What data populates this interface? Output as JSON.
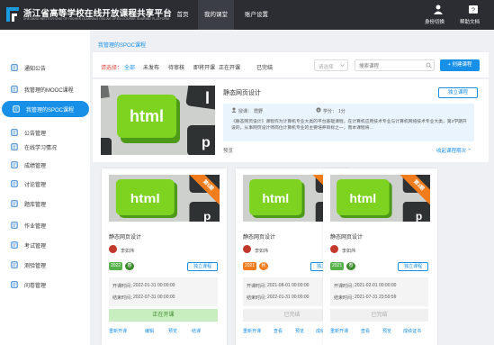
{
  "header": {
    "title": "浙江省高等学校在线开放课程共享平台",
    "subtitle": "ZHEJIANG INSTITUTIONS OF HIGHER LEARNING ONLINE OPEN COURSE SHARING PLATFORM",
    "nav": [
      "首页",
      "我的课堂",
      "账户设置"
    ],
    "actions": [
      {
        "label": "身份切换",
        "icon": "user-switch-icon"
      },
      {
        "label": "帮助文档",
        "icon": "help-icon"
      }
    ]
  },
  "sidebar": {
    "items": [
      {
        "label": "通知公告",
        "icon": "notice-icon"
      },
      {
        "label": "我管理的MOOC课程",
        "icon": "book-icon"
      },
      {
        "label": "我管理的SPOC课程",
        "icon": "book-icon"
      },
      {
        "label": "公告管理",
        "icon": "announce-icon"
      },
      {
        "label": "在线学习情况",
        "icon": "study-icon"
      },
      {
        "label": "成绩管理",
        "icon": "grade-icon"
      },
      {
        "label": "讨论管理",
        "icon": "discuss-icon"
      },
      {
        "label": "题库管理",
        "icon": "question-bank-icon"
      },
      {
        "label": "作业管理",
        "icon": "homework-icon"
      },
      {
        "label": "考试管理",
        "icon": "exam-icon"
      },
      {
        "label": "测验管理",
        "icon": "quiz-icon"
      },
      {
        "label": "问卷管理",
        "icon": "survey-icon"
      }
    ],
    "active_index": 2
  },
  "breadcrumb": "我管理的SPOC课程",
  "filter": {
    "label": "请选择：",
    "options": [
      "全部",
      "未发布",
      "待审核",
      "即将开课",
      "正在开课",
      "已完结"
    ],
    "selected": "全部",
    "select_placeholder": "请选择",
    "search_placeholder": "搜索课程",
    "create_button": "+ 创建课程"
  },
  "featured": {
    "title": "静态网页设计",
    "button": "独立课程",
    "teacher_label": "授课：",
    "teacher": "霓野",
    "credit_label": "学分：",
    "credit": "1分",
    "description": "《静态网页设计》课程作为计算机专业大类的平台基础课程，在计算机应用技术专业与计算机网络技术专业大类，第2学期开设的，从事网页设计师岗位计算机专业的主要培养目标之一，而本课程将…",
    "preview_label": "预览",
    "collapse_label": "收起课程期次 ⌃"
  },
  "cards": [
    {
      "title": "静态网页设计",
      "term": "第5期",
      "teacher": "李如炜",
      "year": "2022",
      "season": "春",
      "season_color": "#56b14a",
      "badge": "独立课程",
      "start_label": "开课时间：",
      "start": "2022-01-31 00:00:00",
      "end_label": "结束时间：",
      "end": "2022-07-31 00:00:00",
      "status": "正在开课",
      "status_active": true,
      "links": [
        "重新开课",
        "编辑",
        "预览",
        "结课"
      ]
    },
    {
      "title": "静态网页设计",
      "term": "第4期",
      "teacher": "李如炜",
      "year": "2021",
      "season": "秋",
      "season_color": "#f07c1d",
      "badge": "独立课程",
      "start_label": "开课时间：",
      "start": "2021-08-01 00:00:00",
      "end_label": "结束时间：",
      "end": "2022-01-31 00:00:00",
      "status": "已完结",
      "status_active": false,
      "links": [
        "重新开课",
        "查看",
        "预览",
        "成绩证书"
      ]
    },
    {
      "title": "静态网页设计",
      "term": "第3期",
      "teacher": "李如炜",
      "year": "2021",
      "season": "春",
      "season_color": "#56b14a",
      "badge": "独立课程",
      "start_label": "开课时间：",
      "start": "2021-02-01 00:00:00",
      "end_label": "结束时间：",
      "end": "2021-07-31 23:59:59",
      "status": "已完结",
      "status_active": false,
      "links": [
        "重新开课",
        "查看",
        "预览",
        "成绩证书"
      ]
    }
  ],
  "thumb_text": "html",
  "colors": {
    "accent": "#1890e8",
    "header": "#2b2d33",
    "ribbon": "#f07c1d",
    "active_status": "#c8eec0"
  }
}
